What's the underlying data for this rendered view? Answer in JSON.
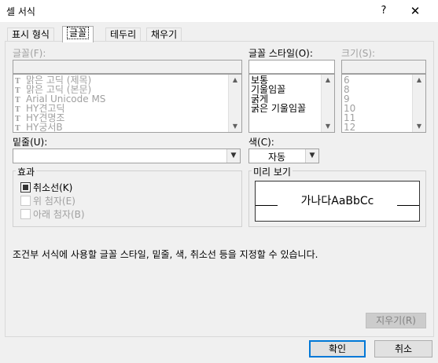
{
  "window": {
    "title": "셀 서식",
    "help": "?",
    "close": "✕"
  },
  "tabs": [
    "표시 형식",
    "글꼴",
    "테두리",
    "채우기"
  ],
  "font": {
    "label": "글꼴(F):",
    "value": "",
    "items": [
      "맑은 고딕 (제목)",
      "맑은 고딕 (본문)",
      "Arial Unicode MS",
      "HY견고딕",
      "HY견명조",
      "HY궁서B"
    ],
    "icon_glyph": "T"
  },
  "style": {
    "label": "글꼴 스타일(O):",
    "value": "",
    "items": [
      "보통",
      "기울임꼴",
      "굵게",
      "굵은 기울임꼴"
    ]
  },
  "size": {
    "label": "크기(S):",
    "value": "",
    "items": [
      "6",
      "8",
      "9",
      "10",
      "11",
      "12"
    ]
  },
  "underline": {
    "label": "밑줄(U):",
    "value": ""
  },
  "color": {
    "label": "색(C):",
    "value": "자동"
  },
  "effects": {
    "label": "효과",
    "strikethrough": {
      "label": "취소선(K)",
      "checked": true
    },
    "superscript": {
      "label": "위 첨자(E)",
      "checked": false
    },
    "subscript": {
      "label": "아래 첨자(B)",
      "checked": false
    }
  },
  "preview": {
    "label": "미리 보기",
    "sample": "가나다AaBbCc"
  },
  "description": "조건부 서식에 사용할 글꼴 스타일, 밑줄, 색, 취소선 등을 지정할 수 있습니다.",
  "buttons": {
    "clear": "지우기(R)",
    "ok": "확인",
    "cancel": "취소"
  },
  "icons": {
    "scroll_up": "▲",
    "scroll_down": "▼",
    "dropdown": "▼"
  }
}
